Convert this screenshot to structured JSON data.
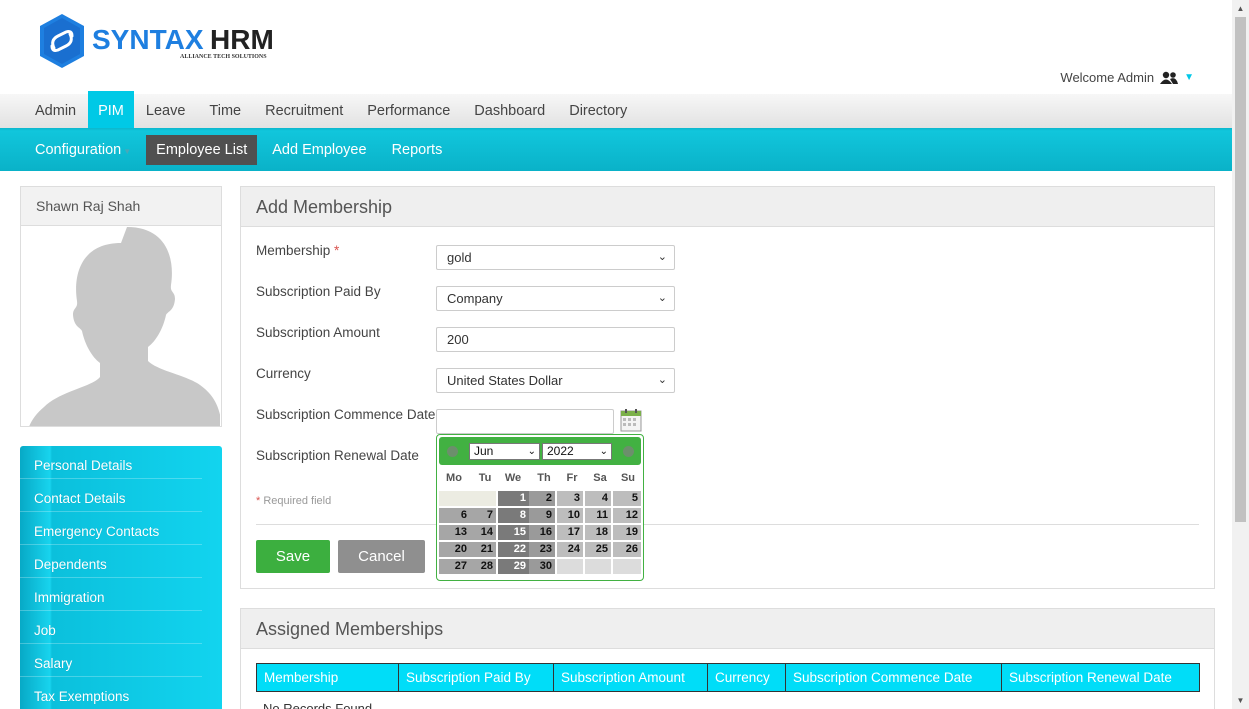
{
  "header": {
    "logo_text_left": "SYNTAX",
    "logo_text_right": "HRM",
    "logo_tagline": "ALLIANCE TECH SOLUTIONS",
    "welcome": "Welcome Admin",
    "brand_color": "#00c9e6"
  },
  "main_menu": [
    {
      "label": "Admin"
    },
    {
      "label": "PIM",
      "active": true
    },
    {
      "label": "Leave"
    },
    {
      "label": "Time"
    },
    {
      "label": "Recruitment"
    },
    {
      "label": "Performance"
    },
    {
      "label": "Dashboard"
    },
    {
      "label": "Directory"
    }
  ],
  "sub_menu": [
    {
      "label": "Configuration"
    },
    {
      "label": "Employee List",
      "active": true
    },
    {
      "label": "Add Employee"
    },
    {
      "label": "Reports"
    }
  ],
  "profile": {
    "name": "Shawn Raj Shah"
  },
  "side_menu": [
    "Personal Details",
    "Contact Details",
    "Emergency Contacts",
    "Dependents",
    "Immigration",
    "Job",
    "Salary",
    "Tax Exemptions"
  ],
  "form": {
    "title": "Add Membership",
    "membership_label": "Membership",
    "required_mark": "*",
    "membership_value": "gold",
    "paid_by_label": "Subscription Paid By",
    "paid_by_value": "Company",
    "amount_label": "Subscription Amount",
    "amount_value": "200",
    "currency_label": "Currency",
    "currency_value": "United States Dollar",
    "commence_label": "Subscription Commence Date",
    "commence_value": "",
    "renewal_label": "Subscription Renewal Date",
    "required_note_mark": "*",
    "required_note": "Required field",
    "save": "Save",
    "cancel": "Cancel"
  },
  "datepicker": {
    "month": "Jun",
    "year": "2022",
    "weekdays": [
      "Mo",
      "Tu",
      "We",
      "Th",
      "Fr",
      "Sa",
      "Su"
    ],
    "first_weekday_index": 2,
    "days": [
      "1",
      "2",
      "3",
      "4",
      "5",
      "6",
      "7",
      "8",
      "9",
      "10",
      "11",
      "12",
      "13",
      "14",
      "15",
      "16",
      "17",
      "18",
      "19",
      "20",
      "21",
      "22",
      "23",
      "24",
      "25",
      "26",
      "27",
      "28",
      "29",
      "30"
    ],
    "accent_color": "#42b142"
  },
  "assigned": {
    "title": "Assigned Memberships",
    "columns": [
      "Membership",
      "Subscription Paid By",
      "Subscription Amount",
      "Currency",
      "Subscription Commence Date",
      "Subscription Renewal Date"
    ],
    "empty_text": "No Records Found"
  }
}
